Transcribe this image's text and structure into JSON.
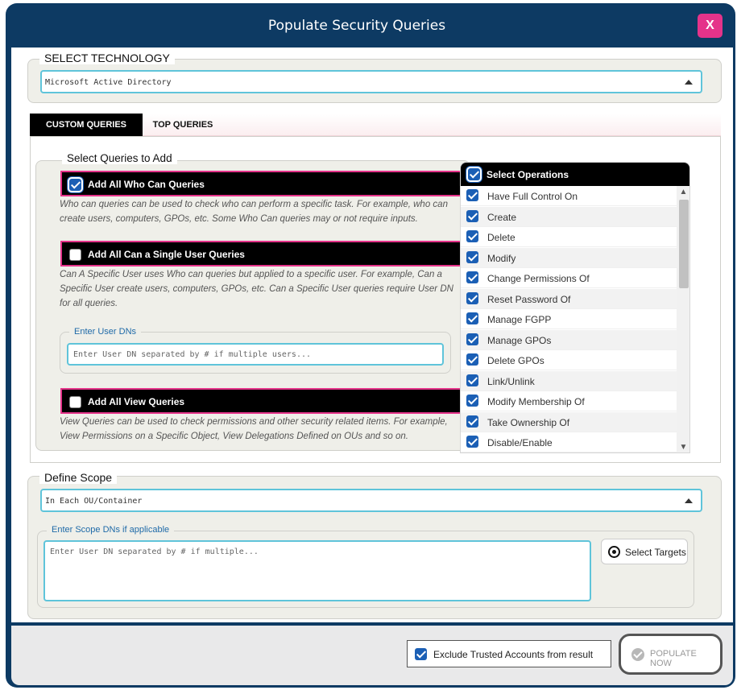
{
  "dialog": {
    "title": "Populate Security Queries",
    "close_label": "X"
  },
  "technology": {
    "legend": "SELECT TECHNOLOGY",
    "selected": "Microsoft Active Directory"
  },
  "tabs": [
    {
      "label": "CUSTOM QUERIES",
      "active": true
    },
    {
      "label": "TOP QUERIES",
      "active": false
    }
  ],
  "queries": {
    "legend": "Select Queries to Add",
    "who_can": {
      "label": "Add All Who Can Queries",
      "checked": true,
      "description": "Who can queries can be used to check who can perform a specific task. For example, who can create users, computers, GPOs, etc. Some Who Can queries may or not require inputs."
    },
    "single_user": {
      "label": "Add All Can a Single User Queries",
      "checked": false,
      "description": "Can A Specific User uses Who can queries but applied to a specific user. For example, Can a Specific User create users, computers, GPOs, etc. Can a Specific User queries require User DN for all queries."
    },
    "user_dns": {
      "legend": "Enter User DNs",
      "placeholder": "Enter User DN separated by # if multiple users..."
    },
    "view": {
      "label": "Add All View Queries",
      "checked": false,
      "description": "View Queries can be used to check permissions and other security related items. For example, View Permissions on a Specific Object, View Delegations Defined on OUs and so on."
    }
  },
  "operations": {
    "header": "Select Operations",
    "items": [
      {
        "label": "Have Full Control On",
        "checked": true
      },
      {
        "label": "Create",
        "checked": true
      },
      {
        "label": "Delete",
        "checked": true
      },
      {
        "label": "Modify",
        "checked": true
      },
      {
        "label": "Change Permissions Of",
        "checked": true
      },
      {
        "label": "Reset Password Of",
        "checked": true
      },
      {
        "label": "Manage FGPP",
        "checked": true
      },
      {
        "label": "Manage GPOs",
        "checked": true
      },
      {
        "label": "Delete GPOs",
        "checked": true
      },
      {
        "label": "Link/Unlink",
        "checked": true
      },
      {
        "label": "Modify Membership Of",
        "checked": true
      },
      {
        "label": "Take Ownership Of",
        "checked": true
      },
      {
        "label": "Disable/Enable",
        "checked": true
      }
    ]
  },
  "scope": {
    "legend": "Define Scope",
    "selected": "In Each OU/Container",
    "dns_legend": "Enter Scope DNs if applicable",
    "placeholder": "Enter User DN separated by # if multiple...",
    "select_targets": "Select Targets"
  },
  "footer": {
    "exclude_label": "Exclude Trusted Accounts from result",
    "exclude_checked": true,
    "populate_label": "POPULATE NOW"
  },
  "colors": {
    "header_bg": "#0d3a63",
    "accent_pink": "#e5338a",
    "checkbox_blue": "#1b5fb5",
    "input_border": "#5fc4da"
  }
}
